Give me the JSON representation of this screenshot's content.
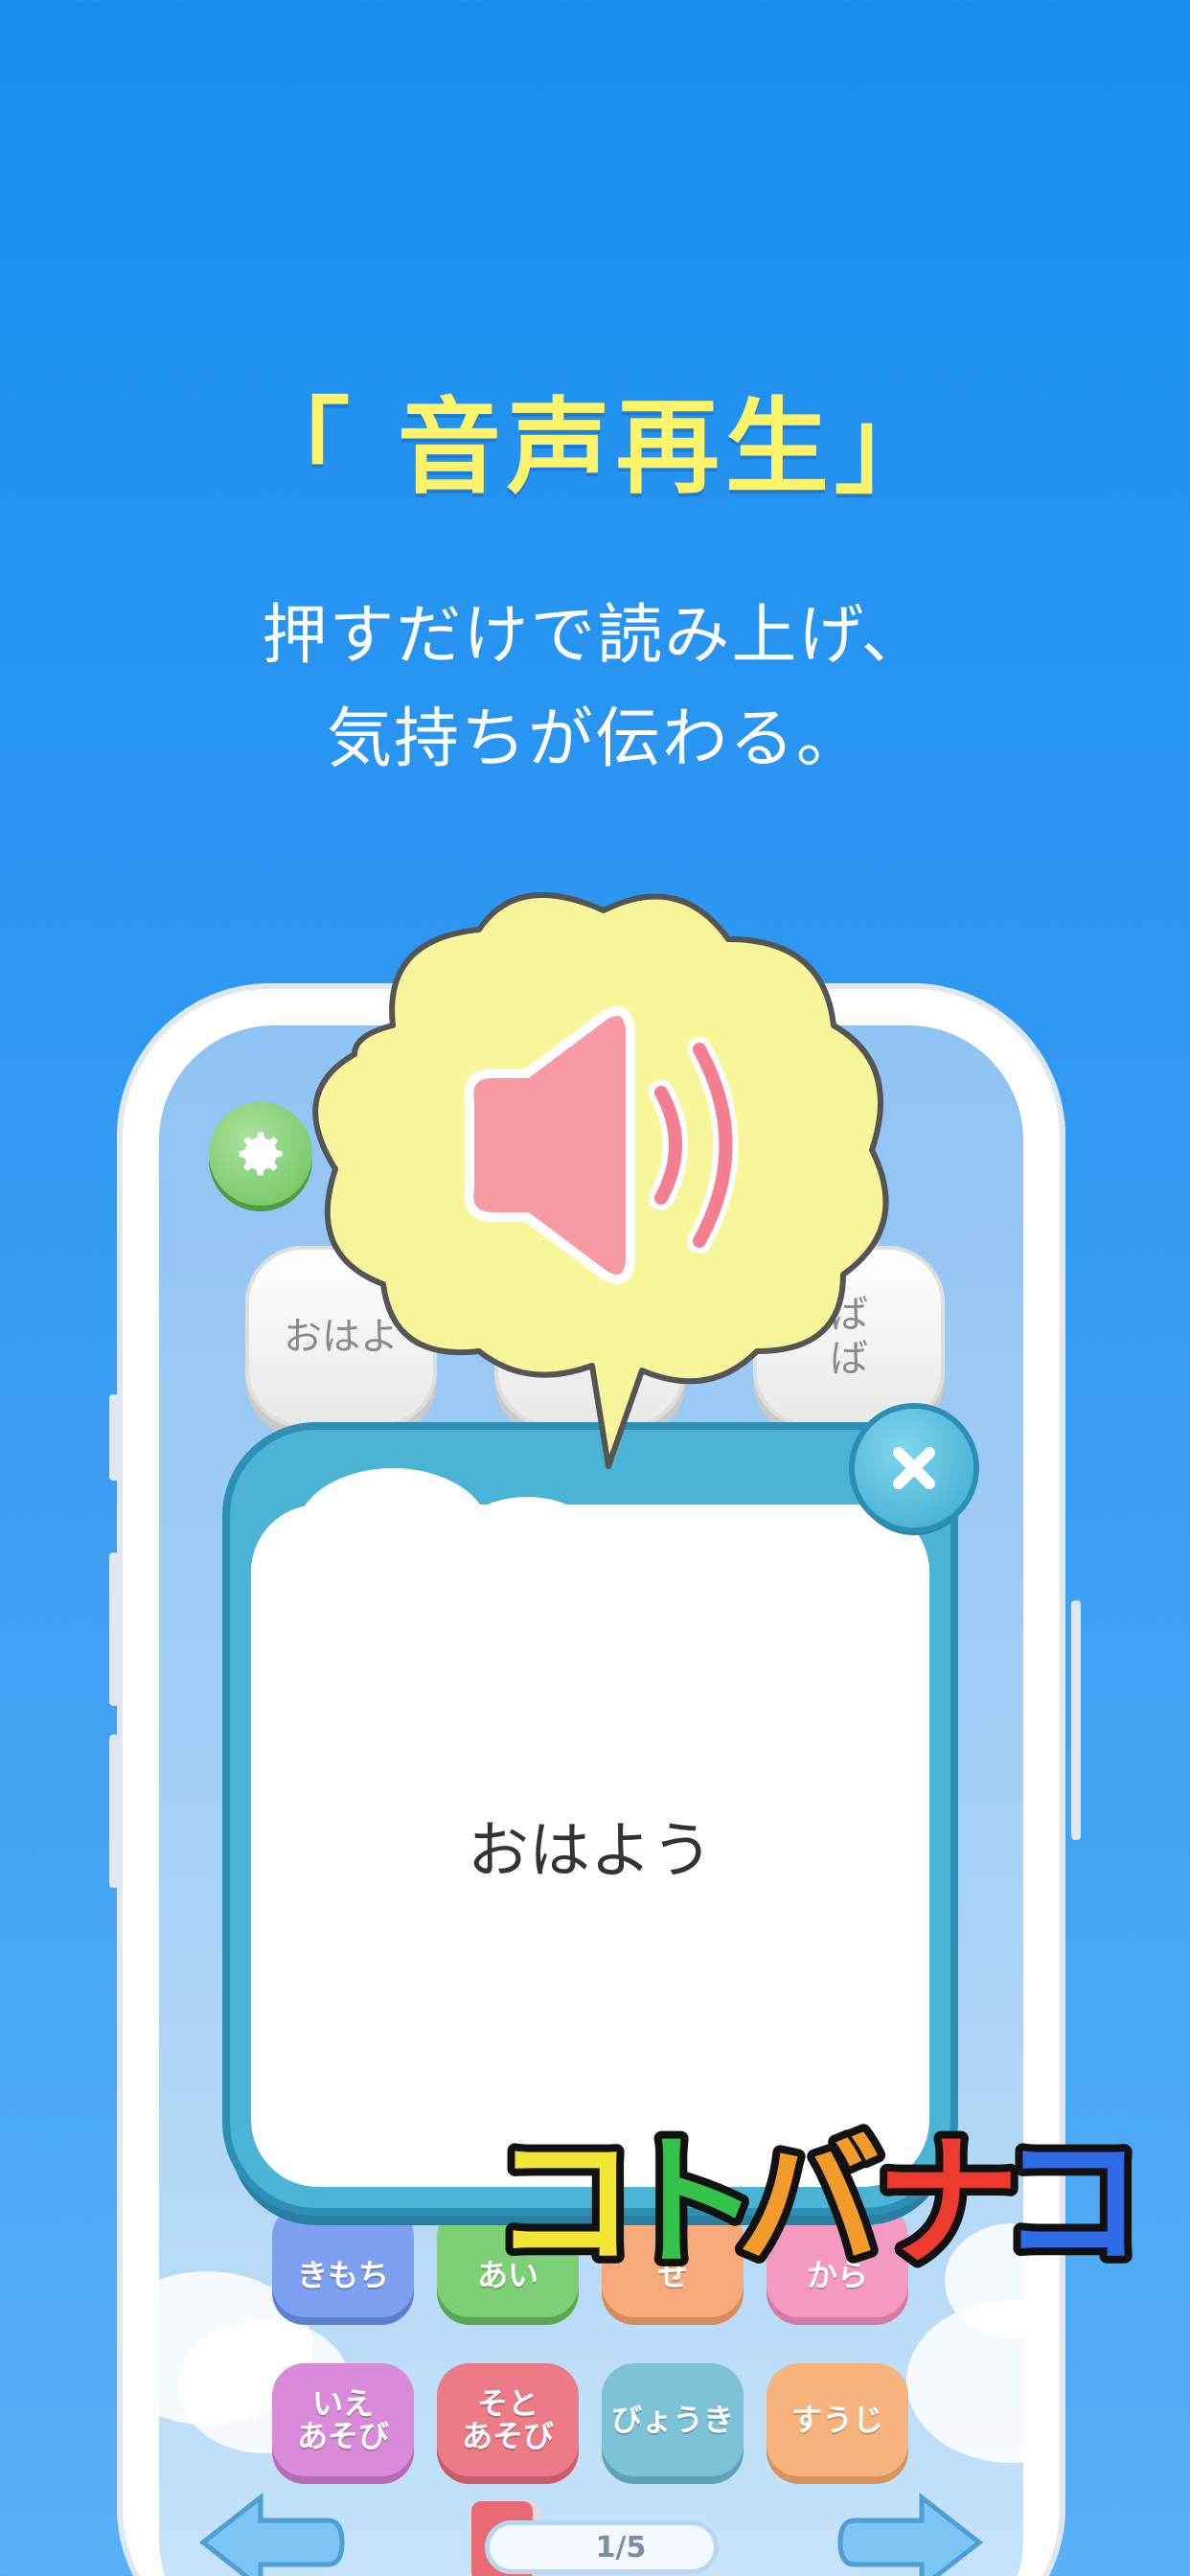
{
  "headline": "「 音声再生」",
  "subline": [
    "押すだけで読み上げ、",
    "気持ちが伝わる。"
  ],
  "settings_icon": "gear-icon",
  "word_cards": [
    "おはよう",
    "",
    "ばいばい"
  ],
  "word_cards_display": [
    "おはよ",
    "",
    "ば\nば"
  ],
  "popup": {
    "text": "おはよう",
    "close_icon": "close-icon"
  },
  "speaker_icon": "speaker-icon",
  "categories_row1": [
    "きもち",
    "あい",
    "せ",
    "から"
  ],
  "categories_row2": [
    {
      "label": "いえ\nあそび",
      "color": "#d98ad8"
    },
    {
      "label": "そと\nあそび",
      "color": "#ec7a87"
    },
    {
      "label": "びょうき",
      "color": "#7ec2d6"
    },
    {
      "label": "すうじ",
      "color": "#f6b37c"
    }
  ],
  "pager": "1/5",
  "logo_letters": [
    {
      "char": "コ",
      "color": "#f2e533"
    },
    {
      "char": "ト",
      "color": "#35c24a"
    },
    {
      "char": "バ",
      "color": "#f29a2a"
    },
    {
      "char": "ナ",
      "color": "#ee3a2e"
    },
    {
      "char": "コ",
      "color": "#2f6be6"
    }
  ]
}
